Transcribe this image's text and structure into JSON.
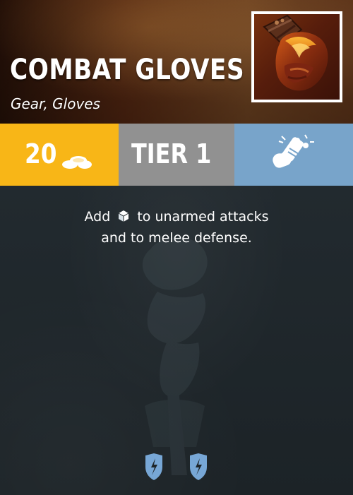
{
  "card": {
    "title": "COMBAT GLOVES",
    "subtitle": "Gear, Gloves",
    "icon": "combat-gloves-portrait"
  },
  "stats": {
    "cost": {
      "value": "20",
      "icon": "coins-icon",
      "color": "#f8b617"
    },
    "tier": {
      "label": "TIER 1",
      "color": "#919191"
    },
    "ability": {
      "icon": "glove-punch-icon",
      "color": "#78a4ca"
    }
  },
  "description": {
    "line1_start": "Add",
    "line1_end": "to unarmed attacks",
    "line2": "and to melee defense.",
    "inline_icon": "die-icon"
  },
  "footer": {
    "icons": [
      "shield-lightning-icon",
      "shield-lightning-icon"
    ],
    "icon_color": "#77a7d6"
  },
  "palette": {
    "header_glow": "#7a4a25",
    "body_background": "#1e2529",
    "text_color": "#ffffff"
  }
}
